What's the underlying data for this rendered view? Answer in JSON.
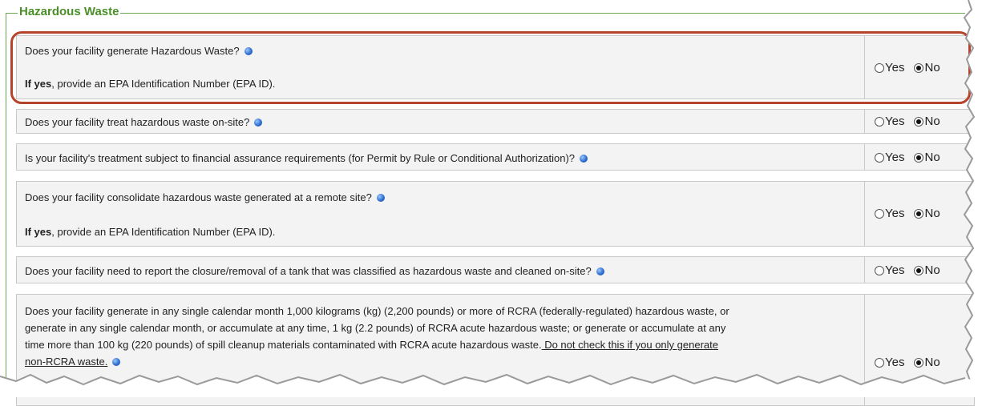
{
  "section": {
    "title": "Hazardous Waste"
  },
  "options": {
    "yes": "Yes",
    "no": "No"
  },
  "questions": [
    {
      "text": "Does your facility generate Hazardous Waste?",
      "note_bold": "If yes",
      "note": ", provide an EPA Identification Number (EPA ID).",
      "selected": "no",
      "highlighted": true
    },
    {
      "text": "Does your facility treat hazardous waste on-site?",
      "selected": "no"
    },
    {
      "text": "Is your facility's treatment subject to financial assurance requirements (for Permit by Rule or Conditional Authorization)?",
      "selected": "no"
    },
    {
      "text": "Does your facility consolidate hazardous waste generated at a remote site?",
      "note_bold": "If yes",
      "note": ", provide an EPA Identification Number (EPA ID).",
      "selected": "no"
    },
    {
      "text": "Does your facility need to report the closure/removal of a tank that was classified as hazardous waste and cleaned on-site?",
      "selected": "no"
    },
    {
      "text_lines": [
        "Does your facility generate in any single calendar month 1,000 kilograms (kg) (2,200 pounds) or more of RCRA (federally-regulated) hazardous waste, or",
        "generate in any single calendar month, or accumulate at any time, 1 kg (2.2 pounds) of RCRA acute hazardous waste; or generate or accumulate at any",
        "time more than 100 kg (220 pounds) of spill cleanup materials contaminated with RCRA acute hazardous waste."
      ],
      "underlined": " Do not check this if you only generate",
      "underlined_2": "non-RCRA waste.",
      "selected": "no"
    }
  ],
  "colors": {
    "legend": "#4b8f29",
    "highlight": "#b5442d",
    "row_bg": "#f3f3f3"
  }
}
